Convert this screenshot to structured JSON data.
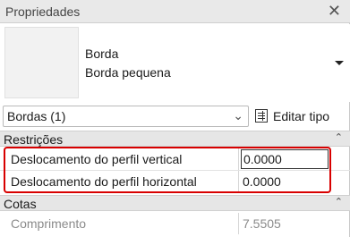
{
  "panel": {
    "title": "Propriedades",
    "close_icon": "close-icon"
  },
  "type": {
    "name": "Borda",
    "subtype": "Borda pequena",
    "dropdown_icon": "dropdown-arrow-icon"
  },
  "selector": {
    "value": "Bordas (1)",
    "edit_type_label": "Editar tipo",
    "edit_type_icon": "edit-type-icon"
  },
  "sections": {
    "restricoes": {
      "label": "Restrições",
      "rows": [
        {
          "name": "Deslocamento do perfil vertical",
          "value": "0.0000"
        },
        {
          "name": "Deslocamento do perfil horizontal",
          "value": "0.0000"
        }
      ]
    },
    "cotas": {
      "label": "Cotas",
      "rows": [
        {
          "name": "Comprimento",
          "value": "7.5505"
        }
      ]
    }
  },
  "colors": {
    "highlight": "#d80000",
    "section_bg": "#e6e6e6"
  }
}
